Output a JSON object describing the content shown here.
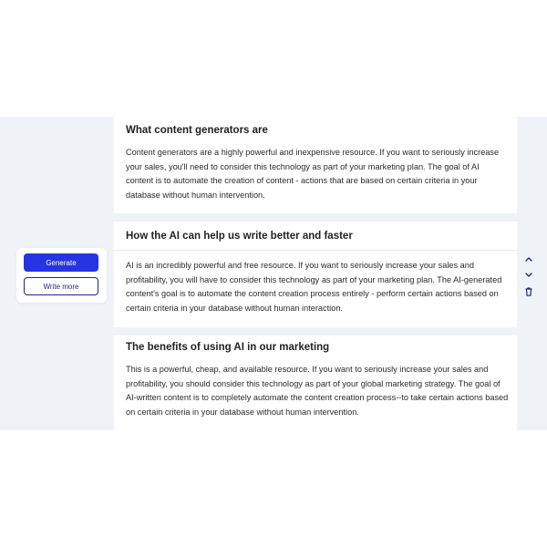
{
  "actions": {
    "generate_label": "Generate",
    "write_more_label": "Write more"
  },
  "sections": [
    {
      "title": "What content generators are",
      "body": "Content generators are a highly powerful and inexpensive resource. If you want to seriously increase your sales, you'll need to consider this technology as part of your marketing plan. The goal of AI content is to automate the creation of content - actions that are based on certain criteria in your database without human intervention."
    },
    {
      "title": "How the AI can help us write better and faster",
      "body": "AI is an incredibly powerful and free resource. If you want to seriously increase your sales and profitability, you will have to consider this technology as part of your marketing plan. The AI-generated content's goal is to automate the content creation process entirely - perform certain actions based on certain criteria in your database without human interaction."
    },
    {
      "title": "The benefits of using AI in our marketing",
      "body": "This is a powerful, cheap, and available resource. If you want to seriously increase your sales and profitability, you should consider this technology as part of your global marketing strategy. The goal of AI-written content is to completely automate the content creation process--to take certain actions based on certain criteria in your database without human intervention."
    }
  ],
  "side_controls": {
    "icons": [
      "chevron-up-icon",
      "chevron-down-icon",
      "trash-icon"
    ]
  },
  "colors": {
    "accent": "#2634e3",
    "outline": "#1f2a7a",
    "background": "#eff3f8",
    "text": "#2b2b2b"
  }
}
